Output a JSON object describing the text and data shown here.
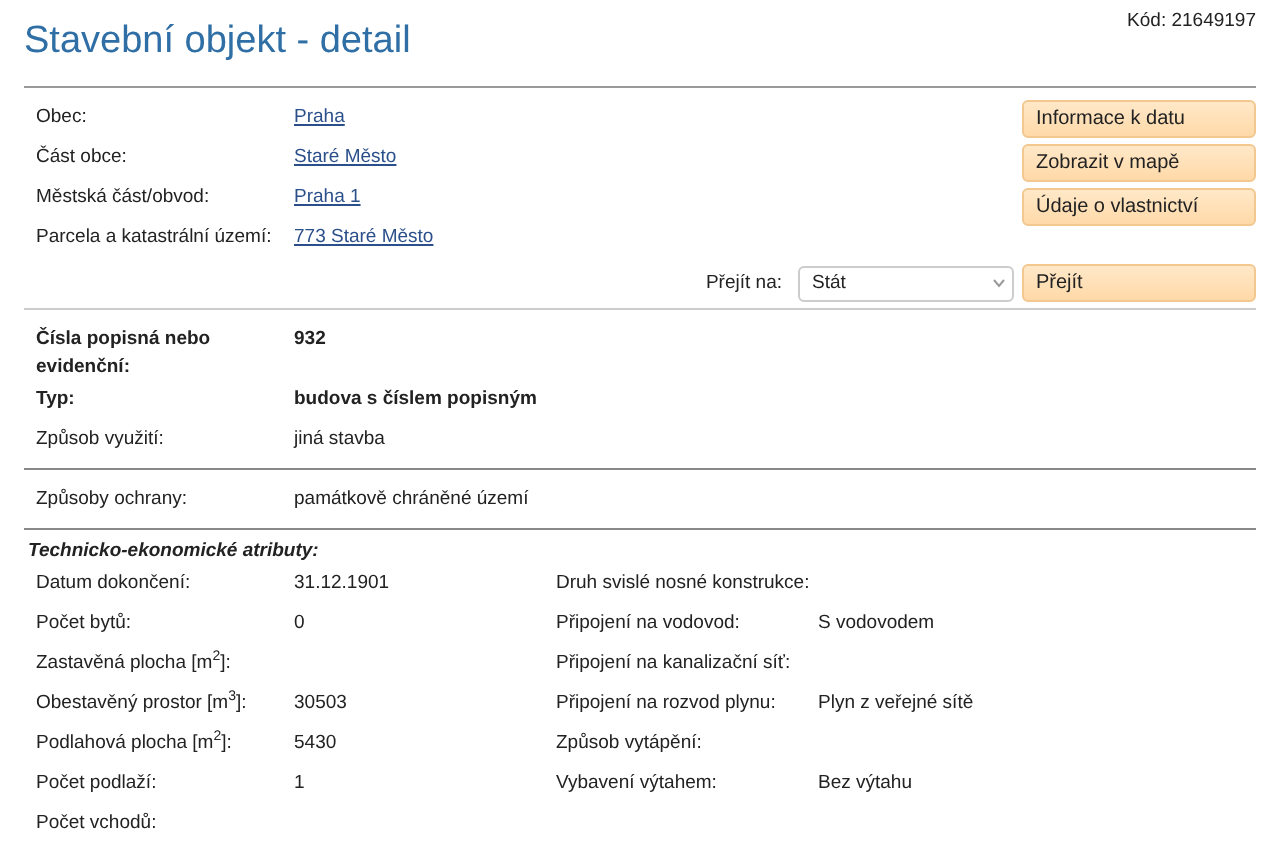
{
  "title": "Stavební objekt - detail",
  "code": "Kód: 21649197",
  "location": [
    {
      "label": "Obec:",
      "value": "Praha"
    },
    {
      "label": "Část obce:",
      "value": "Staré Město"
    },
    {
      "label": "Městská část/obvod:",
      "value": "Praha 1"
    },
    {
      "label": "Parcela a katastrální území:",
      "value": "773 Staré Město"
    }
  ],
  "actions": [
    "Informace k datu",
    "Zobrazit v mapě",
    "Údaje o vlastnictví"
  ],
  "goto": {
    "label": "Přejít na:",
    "value": "Stát",
    "button": "Přejít"
  },
  "identity": [
    {
      "label": "Čísla popisná nebo evidenční:",
      "value": "932",
      "emphasis": true
    },
    {
      "label": "Typ:",
      "value": "budova s číslem popisným",
      "emphasis": true
    },
    {
      "label": "Způsob využití:",
      "value": "jiná stavba",
      "emphasis": false
    }
  ],
  "protection": {
    "label": "Způsoby ochrany:",
    "value": "památkově chráněné území"
  },
  "attributes": {
    "heading": "Technicko-ekonomické atributy:",
    "left": [
      {
        "label": "Datum dokončení:",
        "value": "31.12.1901"
      },
      {
        "label": "Počet bytů:",
        "value": "0"
      },
      {
        "label": "Zastavěná plocha [m$^{2}$]:"
      },
      {
        "label": "Obestavěný prostor [m$^{3}$]:",
        "value": "30503"
      },
      {
        "label": "Podlahová plocha [m$^{2}$]:",
        "value": "5430"
      },
      {
        "label": "Počet podlaží:",
        "value": "1"
      },
      {
        "label": "Počet vchodů:"
      }
    ],
    "right": [
      {
        "label": "Druh svislé nosné konstrukce:"
      },
      {
        "label": "Připojení na vodovod:",
        "value": "S vodovodem"
      },
      {
        "label": "Připojení na kanalizační síť:"
      },
      {
        "label": "Připojení na rozvod plynu:",
        "value": "Plyn z veřejné sítě"
      },
      {
        "label": "Způsob vytápění:"
      },
      {
        "label": "Vybavení výtahem:",
        "value": "Bez výtahu"
      }
    ]
  }
}
